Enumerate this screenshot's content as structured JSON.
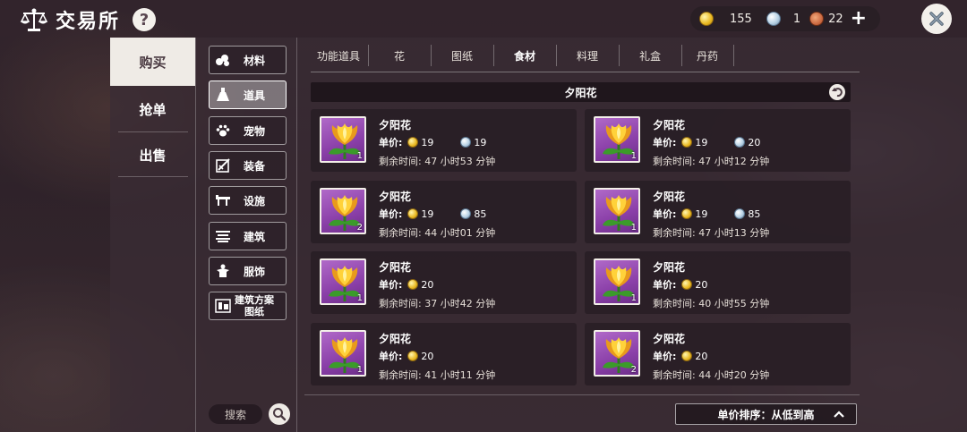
{
  "header": {
    "title": "交易所",
    "help_label": "?",
    "icons": {
      "title": "balance-scale-icon",
      "help": "question-icon",
      "close": "close-icon"
    }
  },
  "currency": {
    "gold": "155",
    "gem": "1",
    "cookie": "22",
    "plus_label": "+"
  },
  "nav": [
    {
      "label": "购买",
      "active": true
    },
    {
      "label": "抢单",
      "active": false
    },
    {
      "label": "出售",
      "active": false
    }
  ],
  "categories": [
    {
      "label": "材料",
      "icon": "material-icon",
      "active": false
    },
    {
      "label": "道具",
      "icon": "flask-icon",
      "active": true
    },
    {
      "label": "宠物",
      "icon": "paw-icon",
      "active": false
    },
    {
      "label": "装备",
      "icon": "equipment-icon",
      "active": false
    },
    {
      "label": "设施",
      "icon": "facility-icon",
      "active": false
    },
    {
      "label": "建筑",
      "icon": "building-icon",
      "active": false
    },
    {
      "label": "服饰",
      "icon": "clothing-icon",
      "active": false
    },
    {
      "label": "建筑方案\n图纸",
      "icon": "blueprint-icon",
      "active": false
    }
  ],
  "search": {
    "label": "搜索"
  },
  "tabs": [
    {
      "label": "功能道具",
      "active": false
    },
    {
      "label": "花",
      "active": false
    },
    {
      "label": "图纸",
      "active": false
    },
    {
      "label": "食材",
      "active": true
    },
    {
      "label": "料理",
      "active": false
    },
    {
      "label": "礼盒",
      "active": false
    },
    {
      "label": "丹药",
      "active": false
    }
  ],
  "item_header": {
    "title": "夕阳花",
    "back_icon": "undo-icon"
  },
  "listing_labels": {
    "price": "单价:",
    "time": "剩余时间:"
  },
  "listings": [
    {
      "name": "夕阳花",
      "qty": "1",
      "gold": "19",
      "gem": "19",
      "time": "47 小时53 分钟"
    },
    {
      "name": "夕阳花",
      "qty": "1",
      "gold": "19",
      "gem": "20",
      "time": "47 小时12 分钟"
    },
    {
      "name": "夕阳花",
      "qty": "2",
      "gold": "19",
      "gem": "85",
      "time": "44 小时01 分钟"
    },
    {
      "name": "夕阳花",
      "qty": "1",
      "gold": "19",
      "gem": "85",
      "time": "47 小时13 分钟"
    },
    {
      "name": "夕阳花",
      "qty": "1",
      "gold": "20",
      "gem": null,
      "time": "37 小时42 分钟"
    },
    {
      "name": "夕阳花",
      "qty": "1",
      "gold": "20",
      "gem": null,
      "time": "40 小时55 分钟"
    },
    {
      "name": "夕阳花",
      "qty": "1",
      "gold": "20",
      "gem": null,
      "time": "41 小时11 分钟"
    },
    {
      "name": "夕阳花",
      "qty": "2",
      "gold": "20",
      "gem": null,
      "time": "44 小时20 分钟"
    }
  ],
  "sort": {
    "label": "单价排序：从低到高",
    "icon": "chevron-up-icon"
  },
  "colors": {
    "panel": "#3a2c34",
    "active_nav": "#efebe6",
    "thumb_bg": "#8a3fa8",
    "coin": "#e9b820"
  }
}
